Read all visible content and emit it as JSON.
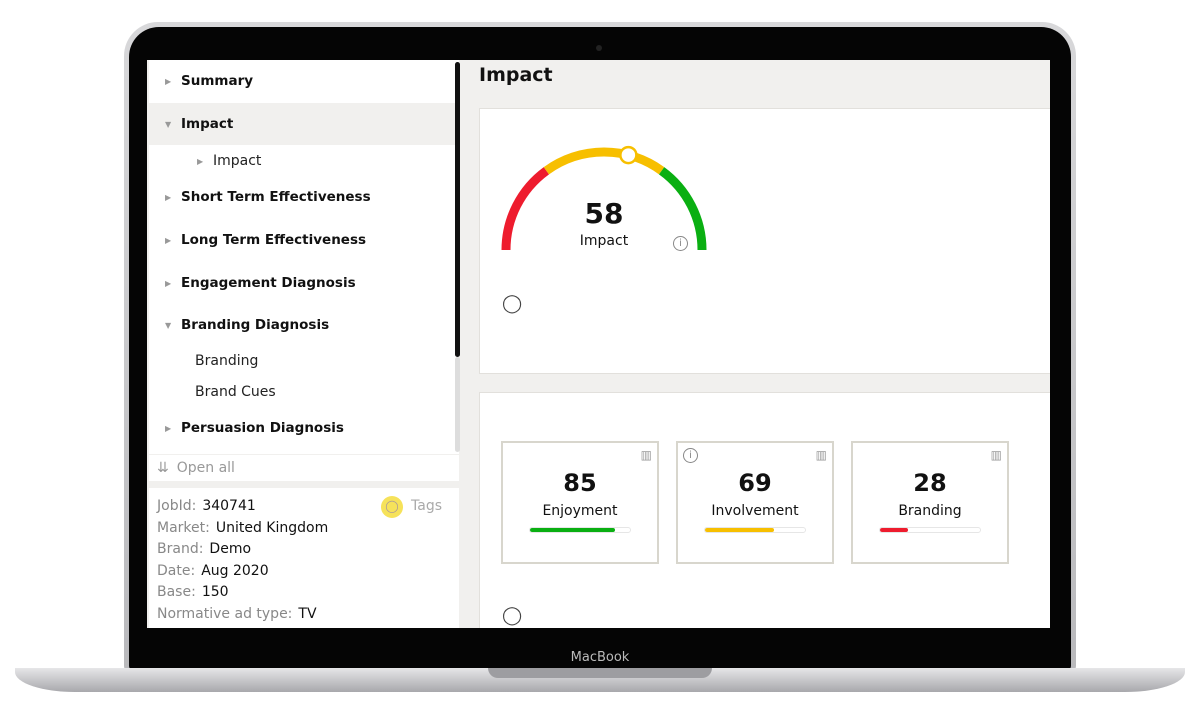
{
  "device_label": "MacBook",
  "sidebar": {
    "items": [
      {
        "label": "Summary",
        "expanded": false
      },
      {
        "label": "Impact",
        "expanded": true,
        "active": true
      },
      {
        "label": "Impact",
        "sub": true
      },
      {
        "label": "Short Term Effectiveness",
        "expanded": false
      },
      {
        "label": "Long Term Effectiveness",
        "expanded": false
      },
      {
        "label": "Engagement Diagnosis",
        "expanded": false
      },
      {
        "label": "Branding Diagnosis",
        "expanded": true
      },
      {
        "label": "Branding",
        "sub": true
      },
      {
        "label": "Brand Cues",
        "sub": true
      },
      {
        "label": "Persuasion Diagnosis",
        "expanded": false
      }
    ],
    "open_all": "Open all"
  },
  "info": {
    "tags": "Tags",
    "fields": [
      {
        "k": "JobId:",
        "v": "340741"
      },
      {
        "k": "Market:",
        "v": "United Kingdom"
      },
      {
        "k": "Brand:",
        "v": "Demo"
      },
      {
        "k": "Date:",
        "v": "Aug 2020"
      },
      {
        "k": "Base:",
        "v": "150"
      },
      {
        "k": "Normative ad type:",
        "v": "TV"
      }
    ]
  },
  "main": {
    "title": "Impact",
    "gauge": {
      "value": 58,
      "label": "Impact",
      "red_end": 30,
      "green_start": 70,
      "colors": {
        "red": "#ee1c2e",
        "yellow": "#f7bf00",
        "green": "#0aaf12"
      }
    },
    "cards": [
      {
        "value": "85",
        "label": "Enjoyment",
        "percent": 85,
        "color": "#0aaf12",
        "info": false
      },
      {
        "value": "69",
        "label": "Involvement",
        "percent": 69,
        "color": "#f7bf00",
        "info": true
      },
      {
        "value": "28",
        "label": "Branding",
        "percent": 28,
        "color": "#ee1c2e",
        "info": false
      }
    ]
  }
}
